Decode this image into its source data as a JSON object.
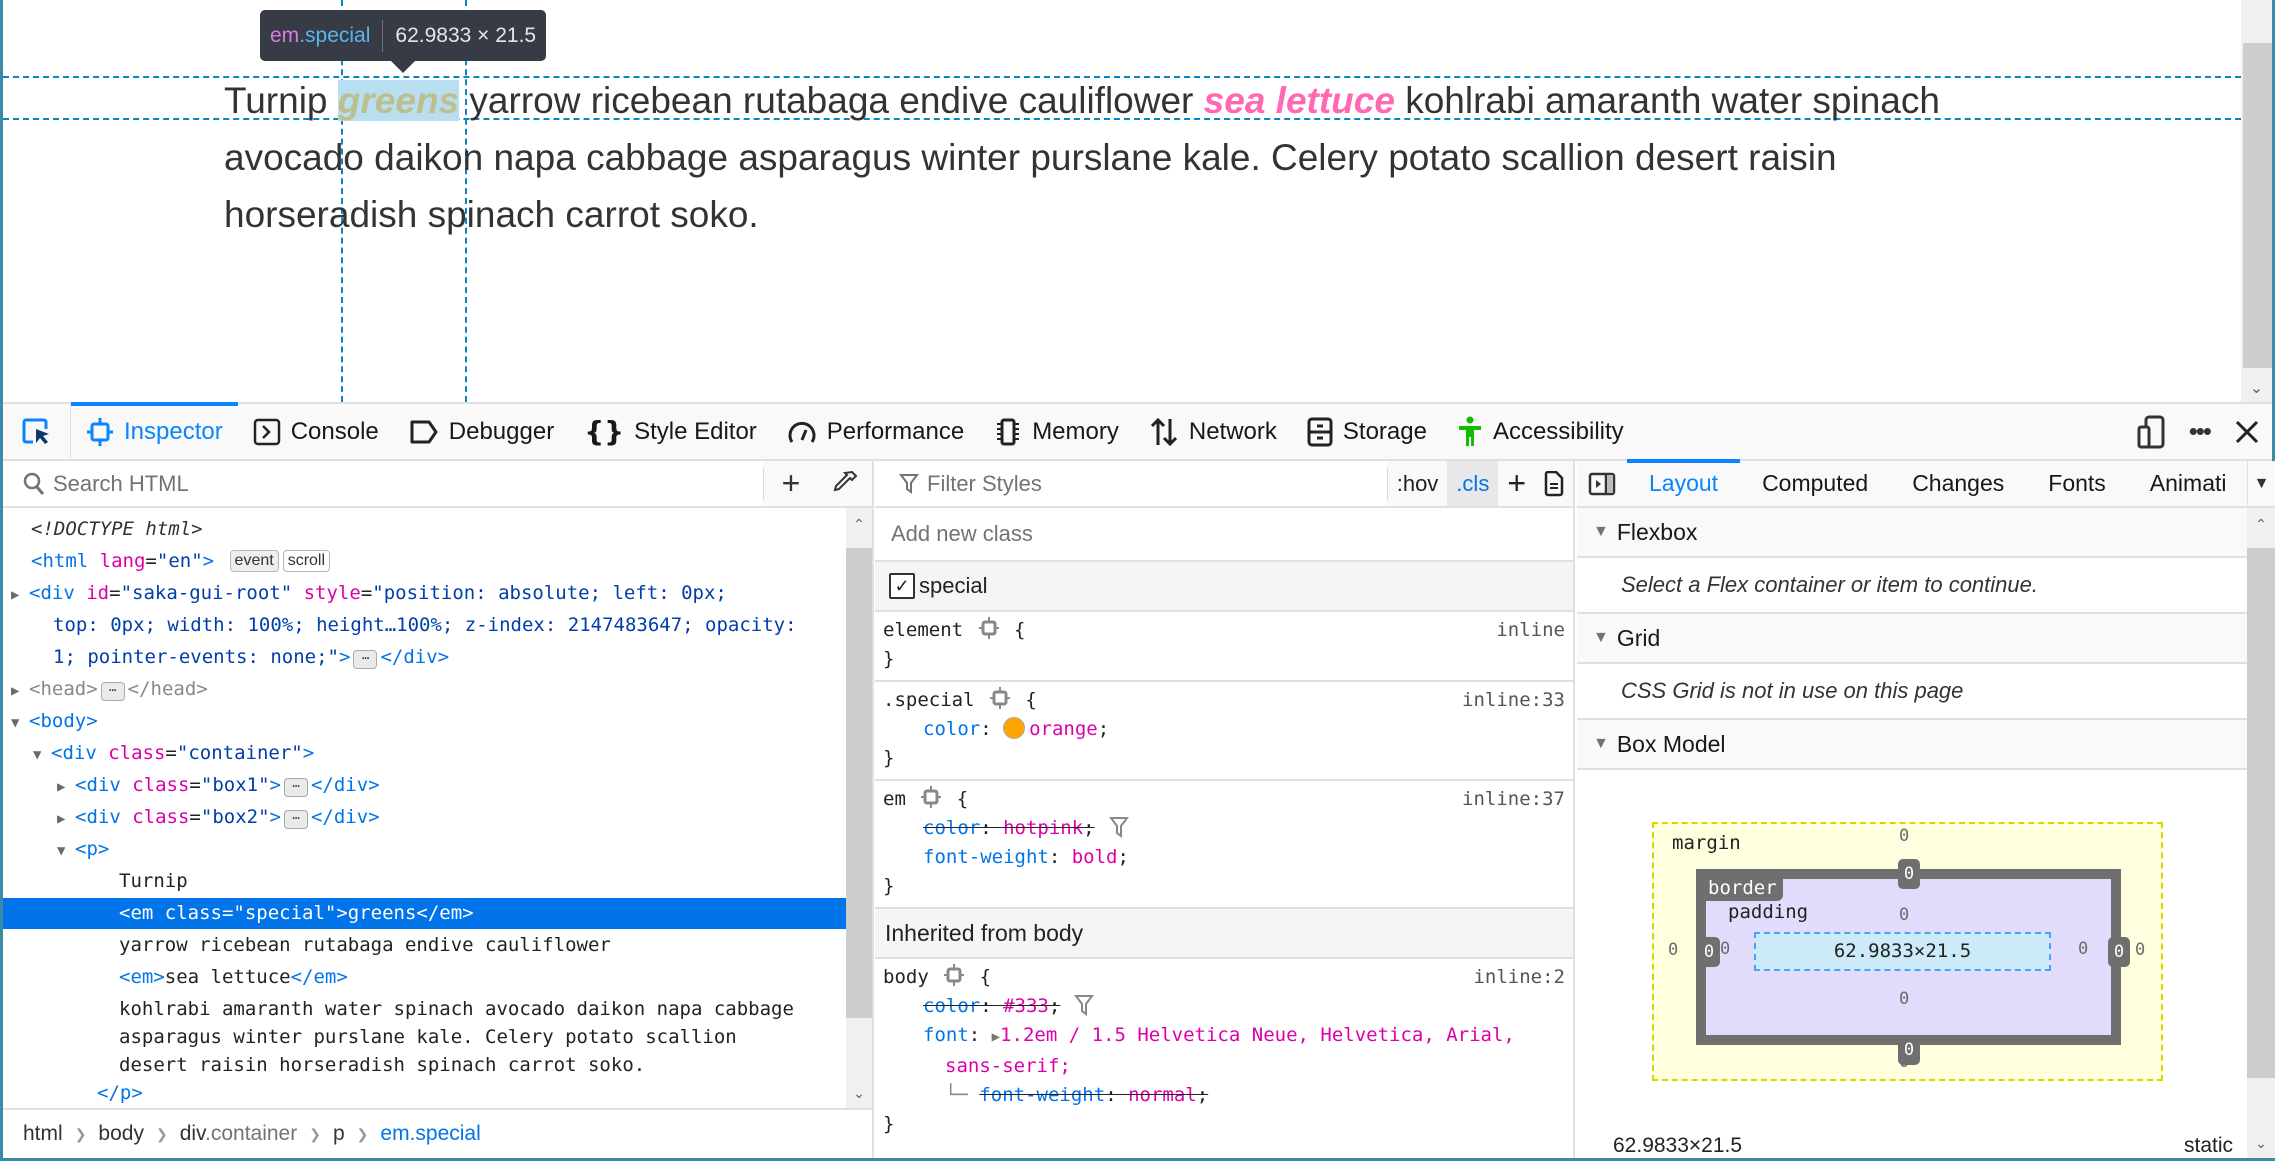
{
  "page": {
    "paragraph": {
      "before": "Turnip ",
      "special": "greens",
      "middle": " yarrow ricebean rutabaga endive cauliflower ",
      "pink": "sea lettuce",
      "after": " kohlrabi amaranth water spinach avocado daikon napa cabbage asparagus winter purslane kale. Celery potato scallion desert raisin horseradish spinach carrot soko."
    },
    "tooltip": {
      "tag": "em",
      "class": ".special",
      "size": "62.9833 × 21.5"
    },
    "colors": {
      "highlight": "#b9def2",
      "guide": "#0a84c4",
      "special_text": "#bcc08f",
      "pink": "#ff69b4"
    }
  },
  "toolbar": {
    "pick_icon": "element-picker-icon",
    "tabs": [
      {
        "label": "Inspector",
        "icon": "inspector-icon",
        "active": true
      },
      {
        "label": "Console",
        "icon": "console-icon"
      },
      {
        "label": "Debugger",
        "icon": "debugger-icon"
      },
      {
        "label": "Style Editor",
        "icon": "style-editor-icon"
      },
      {
        "label": "Performance",
        "icon": "performance-icon"
      },
      {
        "label": "Memory",
        "icon": "memory-icon"
      },
      {
        "label": "Network",
        "icon": "network-icon"
      },
      {
        "label": "Storage",
        "icon": "storage-icon"
      },
      {
        "label": "Accessibility",
        "icon": "accessibility-icon"
      }
    ],
    "right": [
      "responsive-design-icon",
      "more-options-icon",
      "close-icon"
    ]
  },
  "inspector": {
    "search_placeholder": "Search HTML",
    "tree": {
      "doctype": "<!DOCTYPE html>",
      "html_open": {
        "tag": "<html",
        "attr": "lang",
        "val": "\"en\"",
        "close": ">",
        "badges": [
          "event",
          "scroll"
        ]
      },
      "saka": {
        "line1_tag": "<div",
        "id_attr": "id",
        "id_val": "\"saka-gui-root\"",
        "style_attr": "style",
        "line1_val": "\"position: absolute; left: 0px;",
        "line2_val": "top: 0px; width: 100%; height…100%; z-index: 2147483647; opacity:",
        "line3_val": "1; pointer-events: none;\"",
        "close": "</div>"
      },
      "head": {
        "open": "<head>",
        "close": "</head>"
      },
      "body": "<body>",
      "container": {
        "tag": "<div",
        "attr": "class",
        "val": "\"container\"",
        "close": ">"
      },
      "box1": {
        "tag": "<div",
        "attr": "class",
        "val": "\"box1\"",
        "close": ">",
        "end": "</div>"
      },
      "box2": {
        "tag": "<div",
        "attr": "class",
        "val": "\"box2\"",
        "close": ">",
        "end": "</div>"
      },
      "p_open": "<p>",
      "text1": "Turnip",
      "selected": "<em class=\"special\">greens</em>",
      "text2": "yarrow ricebean rutabaga endive cauliflower",
      "em2": {
        "open": "<em>",
        "text": "sea lettuce",
        "close": "</em>"
      },
      "text3_l1": "kohlrabi amaranth water spinach avocado daikon napa cabbage",
      "text3_l2": "asparagus winter purslane kale. Celery potato scallion",
      "text3_l3": "desert raisin horseradish spinach carrot soko.",
      "p_close": "</p>"
    },
    "breadcrumbs": [
      {
        "tag": "html"
      },
      {
        "tag": "body"
      },
      {
        "tag": "div",
        "cls": ".container"
      },
      {
        "tag": "p"
      },
      {
        "tag": "em",
        "cls": ".special",
        "current": true
      }
    ]
  },
  "rules": {
    "filter_placeholder": "Filter Styles",
    "hov": ":hov",
    "cls": ".cls",
    "add_class_placeholder": "Add new class",
    "classes": [
      {
        "name": "special",
        "checked": true
      }
    ],
    "element": {
      "selector": "element",
      "source": "inline"
    },
    "special": {
      "selector": ".special",
      "source": "inline:33",
      "prop": "color",
      "value": "orange",
      "swatch": "#ffa500"
    },
    "em": {
      "selector": "em",
      "source": "inline:37",
      "decls": [
        {
          "prop": "color",
          "value": "hotpink",
          "overridden": true
        },
        {
          "prop": "font-weight",
          "value": "bold"
        }
      ]
    },
    "inherited_label": "Inherited from body",
    "body": {
      "selector": "body",
      "source": "inline:2",
      "color": {
        "prop": "color",
        "value": "#333",
        "overridden": true
      },
      "font": {
        "prop": "font",
        "value_l1": "1.2em / 1.5 Helvetica Neue, Helvetica, Arial,",
        "value_l2": "sans-serif;"
      },
      "sub": {
        "prop": "font-weight",
        "value": "normal",
        "overridden": true
      }
    }
  },
  "layout": {
    "tabs": [
      "Layout",
      "Computed",
      "Changes",
      "Fonts",
      "Animati"
    ],
    "active_tab": "Layout",
    "flexbox": {
      "title": "Flexbox",
      "message": "Select a Flex container or item to continue."
    },
    "grid": {
      "title": "Grid",
      "message": "CSS Grid is not in use on this page"
    },
    "boxmodel": {
      "title": "Box Model",
      "margin_label": "margin",
      "border_label": "border",
      "padding_label": "padding",
      "margin": {
        "top": "0",
        "right": "0",
        "bottom": "0",
        "left": "0"
      },
      "border": {
        "top": "0",
        "right": "0",
        "bottom": "0",
        "left": "0"
      },
      "padding": {
        "top": "0",
        "right": "0",
        "bottom": "0",
        "left": "0"
      },
      "content": "62.9833×21.5",
      "footer_size": "62.9833×21.5",
      "footer_position": "static"
    }
  }
}
